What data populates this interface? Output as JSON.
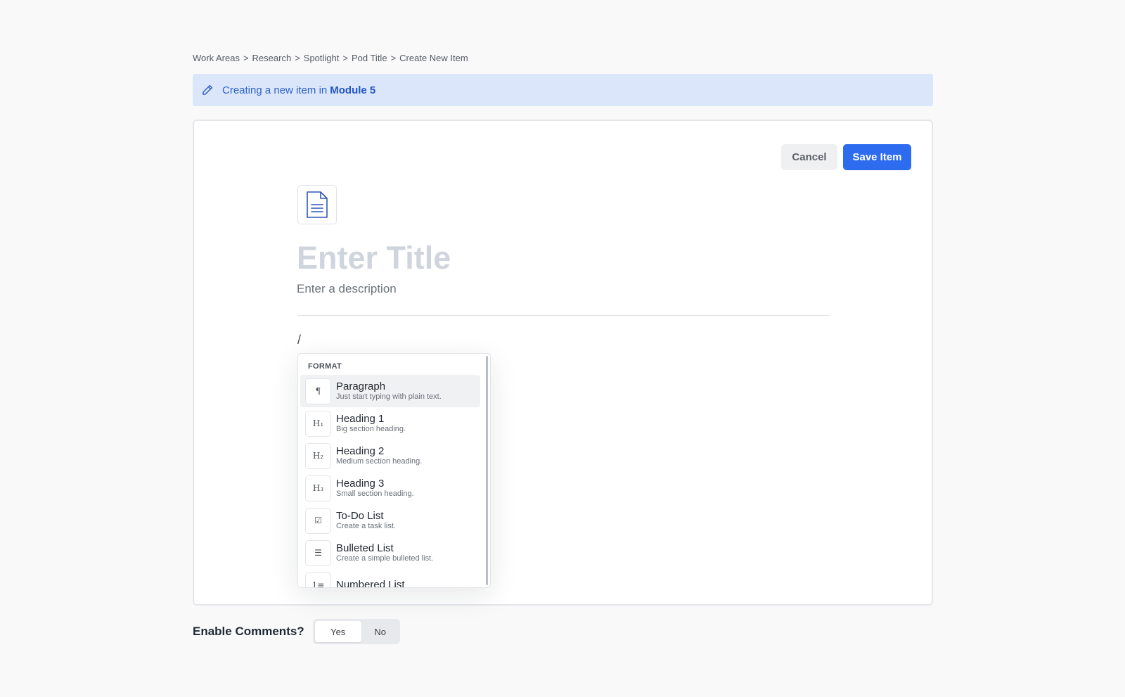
{
  "breadcrumb": [
    "Work Areas",
    "Research",
    "Spotlight",
    "Pod Title",
    "Create New Item"
  ],
  "breadcrumb_separator": ">",
  "banner": {
    "icon": "pencil-icon",
    "text": "Creating a new item in",
    "module": "Module 5"
  },
  "toolbar": {
    "cancel_label": "Cancel",
    "save_label": "Save Item"
  },
  "editor": {
    "doc_icon": "document-icon",
    "title_placeholder": "Enter Title",
    "description_placeholder": "Enter a description",
    "slash": "/"
  },
  "format_menu": {
    "heading": "FORMAT",
    "items": [
      {
        "icon": "paragraph-icon",
        "glyph": "¶",
        "label": "Paragraph",
        "desc": "Just start typing with plain text."
      },
      {
        "icon": "heading-1-icon",
        "glyph": "H₁",
        "label": "Heading 1",
        "desc": "Big section heading."
      },
      {
        "icon": "heading-2-icon",
        "glyph": "H₂",
        "label": "Heading 2",
        "desc": "Medium section heading."
      },
      {
        "icon": "heading-3-icon",
        "glyph": "H₃",
        "label": "Heading 3",
        "desc": "Small section heading."
      },
      {
        "icon": "checkbox-icon",
        "glyph": "☑",
        "label": "To-Do List",
        "desc": "Create a task list."
      },
      {
        "icon": "bullet-list-icon",
        "glyph": "☰",
        "label": "Bulleted List",
        "desc": "Create a simple bulleted list."
      },
      {
        "icon": "numbered-list-icon",
        "glyph": "1≡",
        "label": "Numbered List",
        "desc": ""
      }
    ]
  },
  "comments": {
    "label": "Enable Comments?",
    "yes": "Yes",
    "no": "No",
    "selected": "Yes"
  },
  "colors": {
    "accent": "#2d6bef",
    "banner_bg": "#dbe6fb",
    "banner_text": "#2f62c9"
  }
}
